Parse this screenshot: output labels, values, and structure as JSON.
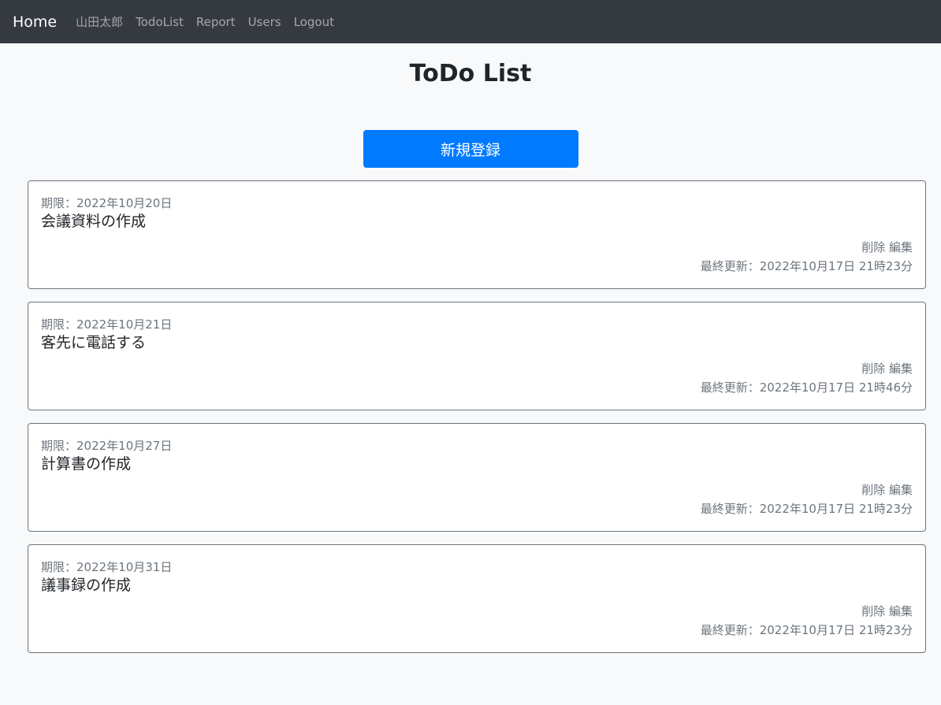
{
  "nav": {
    "brand": "Home",
    "links": [
      "山田太郎",
      "TodoList",
      "Report",
      "Users",
      "Logout"
    ]
  },
  "page": {
    "title": "ToDo List",
    "new_button": "新規登録"
  },
  "todos": [
    {
      "deadline": "期限：2022年10月20日",
      "title": "会議資料の作成",
      "delete": "削除",
      "edit": "編集",
      "updated": "最終更新：2022年10月17日 21時23分"
    },
    {
      "deadline": "期限：2022年10月21日",
      "title": "客先に電話する",
      "delete": "削除",
      "edit": "編集",
      "updated": "最終更新：2022年10月17日 21時46分"
    },
    {
      "deadline": "期限：2022年10月27日",
      "title": "計算書の作成",
      "delete": "削除",
      "edit": "編集",
      "updated": "最終更新：2022年10月17日 21時23分"
    },
    {
      "deadline": "期限：2022年10月31日",
      "title": "議事録の作成",
      "delete": "削除",
      "edit": "編集",
      "updated": "最終更新：2022年10月17日 21時23分"
    }
  ],
  "colors": {
    "navbar_bg": "#343a40",
    "primary": "#007bff",
    "muted": "#6c757d",
    "page_bg": "#f8f9fa"
  }
}
